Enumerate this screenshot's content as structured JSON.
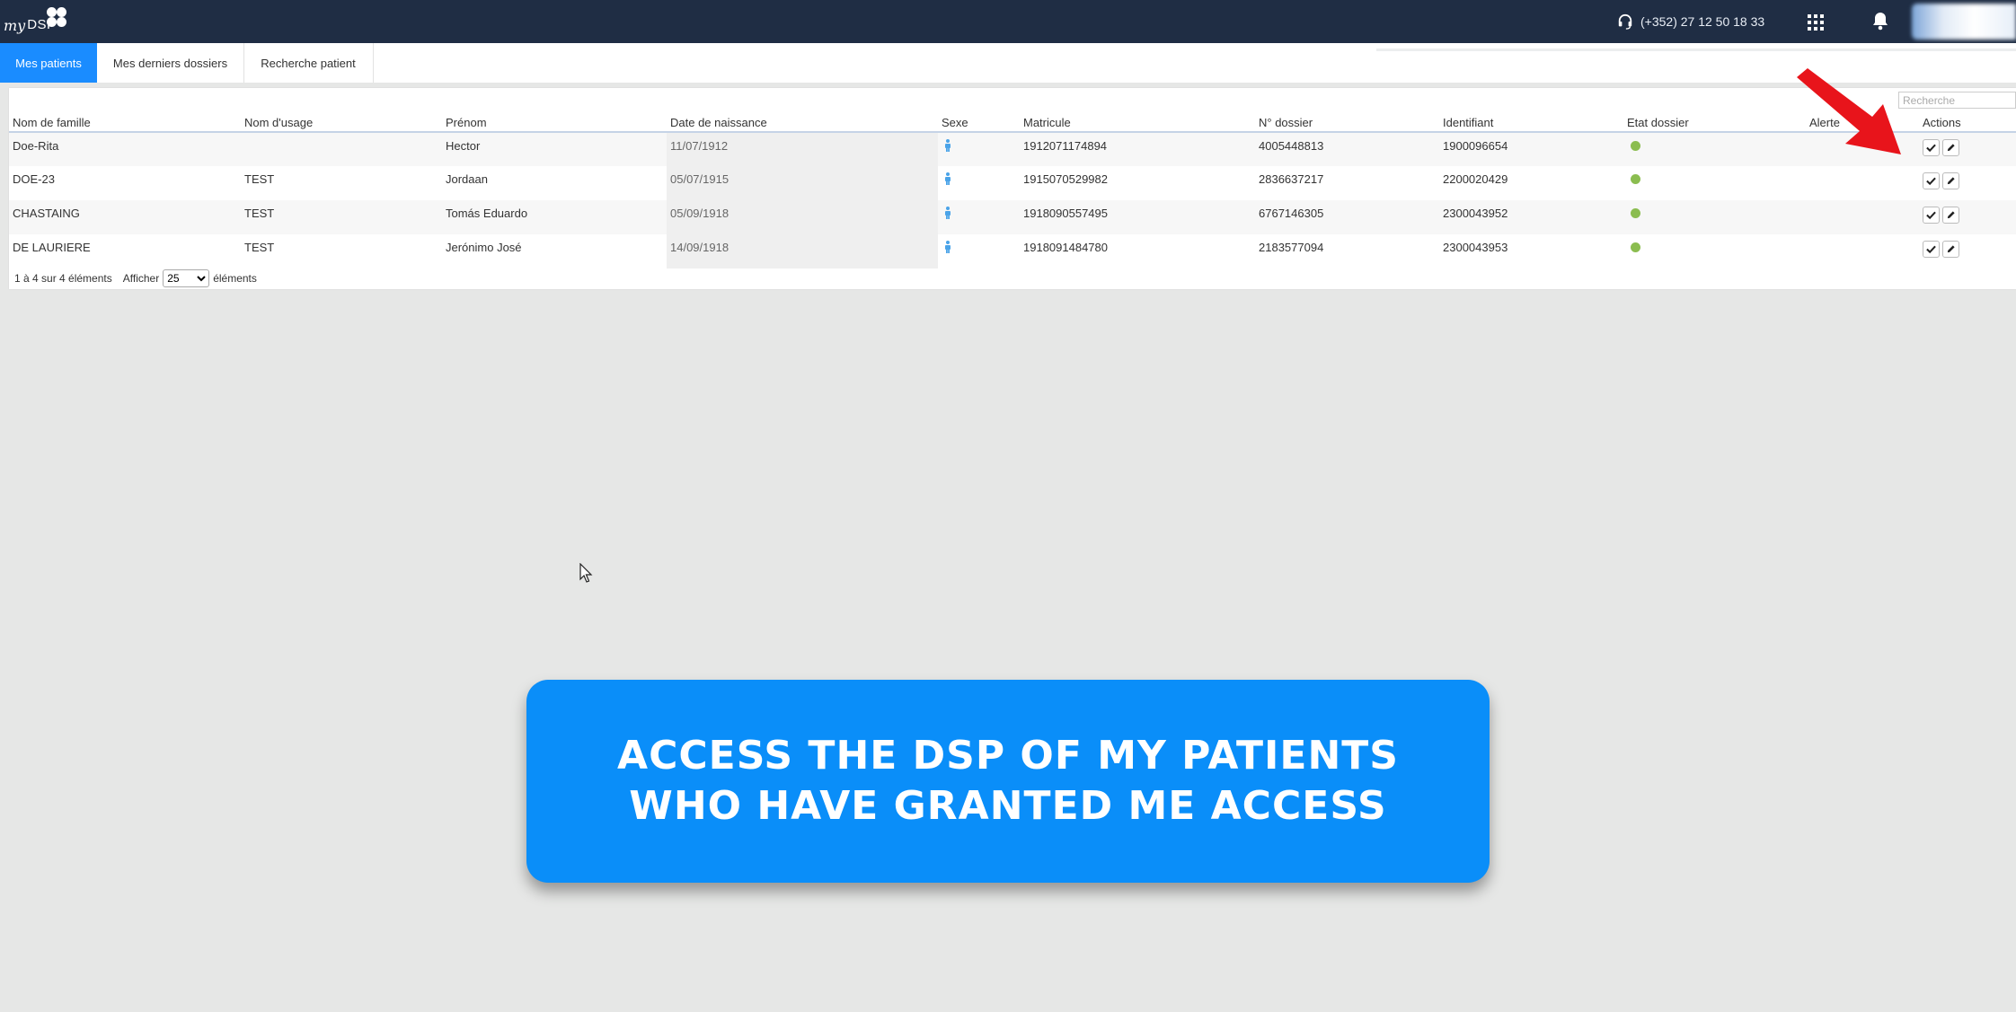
{
  "app": {
    "logo_my": "my",
    "logo_dsp": "DSP",
    "phone": "(+352) 27 12 50 18 33"
  },
  "tabs": [
    {
      "label": "Mes patients",
      "active": true
    },
    {
      "label": "Mes derniers dossiers",
      "active": false
    },
    {
      "label": "Recherche patient",
      "active": false
    }
  ],
  "search": {
    "placeholder": "Recherche"
  },
  "table": {
    "headers": [
      "Nom de famille",
      "Nom d'usage",
      "Prénom",
      "Date de naissance",
      "Sexe",
      "Matricule",
      "N° dossier",
      "Identifiant",
      "Etat dossier",
      "Alerte",
      "Actions"
    ],
    "rows": [
      {
        "nom": "Doe-Rita",
        "usage": "",
        "prenom": "Hector",
        "dob": "11/07/1912",
        "sexe": "male",
        "matricule": "1912071174894",
        "dossier": "4005448813",
        "identifiant": "1900096654",
        "etat": "green"
      },
      {
        "nom": "DOE-23",
        "usage": "TEST",
        "prenom": "Jordaan",
        "dob": "05/07/1915",
        "sexe": "male",
        "matricule": "1915070529982",
        "dossier": "2836637217",
        "identifiant": "2200020429",
        "etat": "green"
      },
      {
        "nom": "CHASTAING",
        "usage": "TEST",
        "prenom": "Tomás Eduardo",
        "dob": "05/09/1918",
        "sexe": "male",
        "matricule": "1918090557495",
        "dossier": "6767146305",
        "identifiant": "2300043952",
        "etat": "green"
      },
      {
        "nom": "DE LAURIERE",
        "usage": "TEST",
        "prenom": "Jerónimo José",
        "dob": "14/09/1918",
        "sexe": "male",
        "matricule": "1918091484780",
        "dossier": "2183577094",
        "identifiant": "2300043953",
        "etat": "green"
      }
    ]
  },
  "pager": {
    "info": "1 à 4 sur 4 éléments",
    "show_label": "Afficher",
    "page_size": "25",
    "suffix": "éléments"
  },
  "banner": {
    "line1": "ACCESS THE DSP OF MY PATIENTS",
    "line2": "WHO HAVE GRANTED ME ACCESS"
  },
  "colors": {
    "topbar": "#1f2d44",
    "accent": "#1a8cff",
    "banner": "#0a8ef9",
    "status_green": "#8bbd50",
    "arrow": "#e8141b"
  }
}
